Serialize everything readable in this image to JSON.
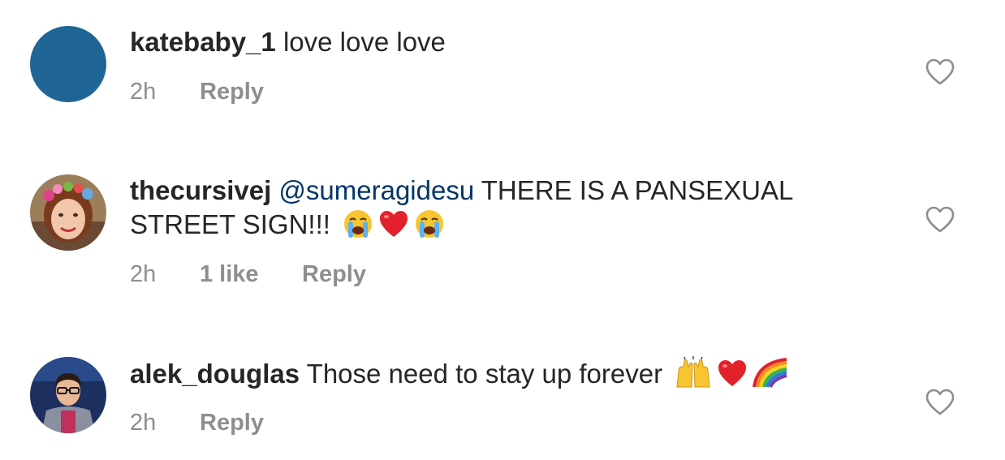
{
  "comments": [
    {
      "username": "katebaby_1",
      "mention": "",
      "text": " love love love",
      "time": "2h",
      "likes": "",
      "reply_label": "Reply",
      "avatar_color": "#1f6696"
    },
    {
      "username": "thecursivej",
      "mention": "@sumeragidesu",
      "text": " THERE IS A PANSEXUAL STREET SIGN!!!",
      "emojis": [
        "loudly-crying-face-icon",
        "red-heart-icon",
        "loudly-crying-face-icon"
      ],
      "time": "2h",
      "likes": "1 like",
      "reply_label": "Reply"
    },
    {
      "username": "alek_douglas",
      "mention": "",
      "text": " Those need to stay up forever",
      "emojis": [
        "raising-hands-icon",
        "red-heart-icon",
        "rainbow-icon"
      ],
      "time": "2h",
      "likes": "",
      "reply_label": "Reply"
    }
  ],
  "colors": {
    "text": "#262626",
    "meta": "#8e8e8e",
    "mention": "#003569",
    "heart_outline": "#8e8e8e"
  },
  "icons": {
    "like": "heart-outline-icon"
  }
}
